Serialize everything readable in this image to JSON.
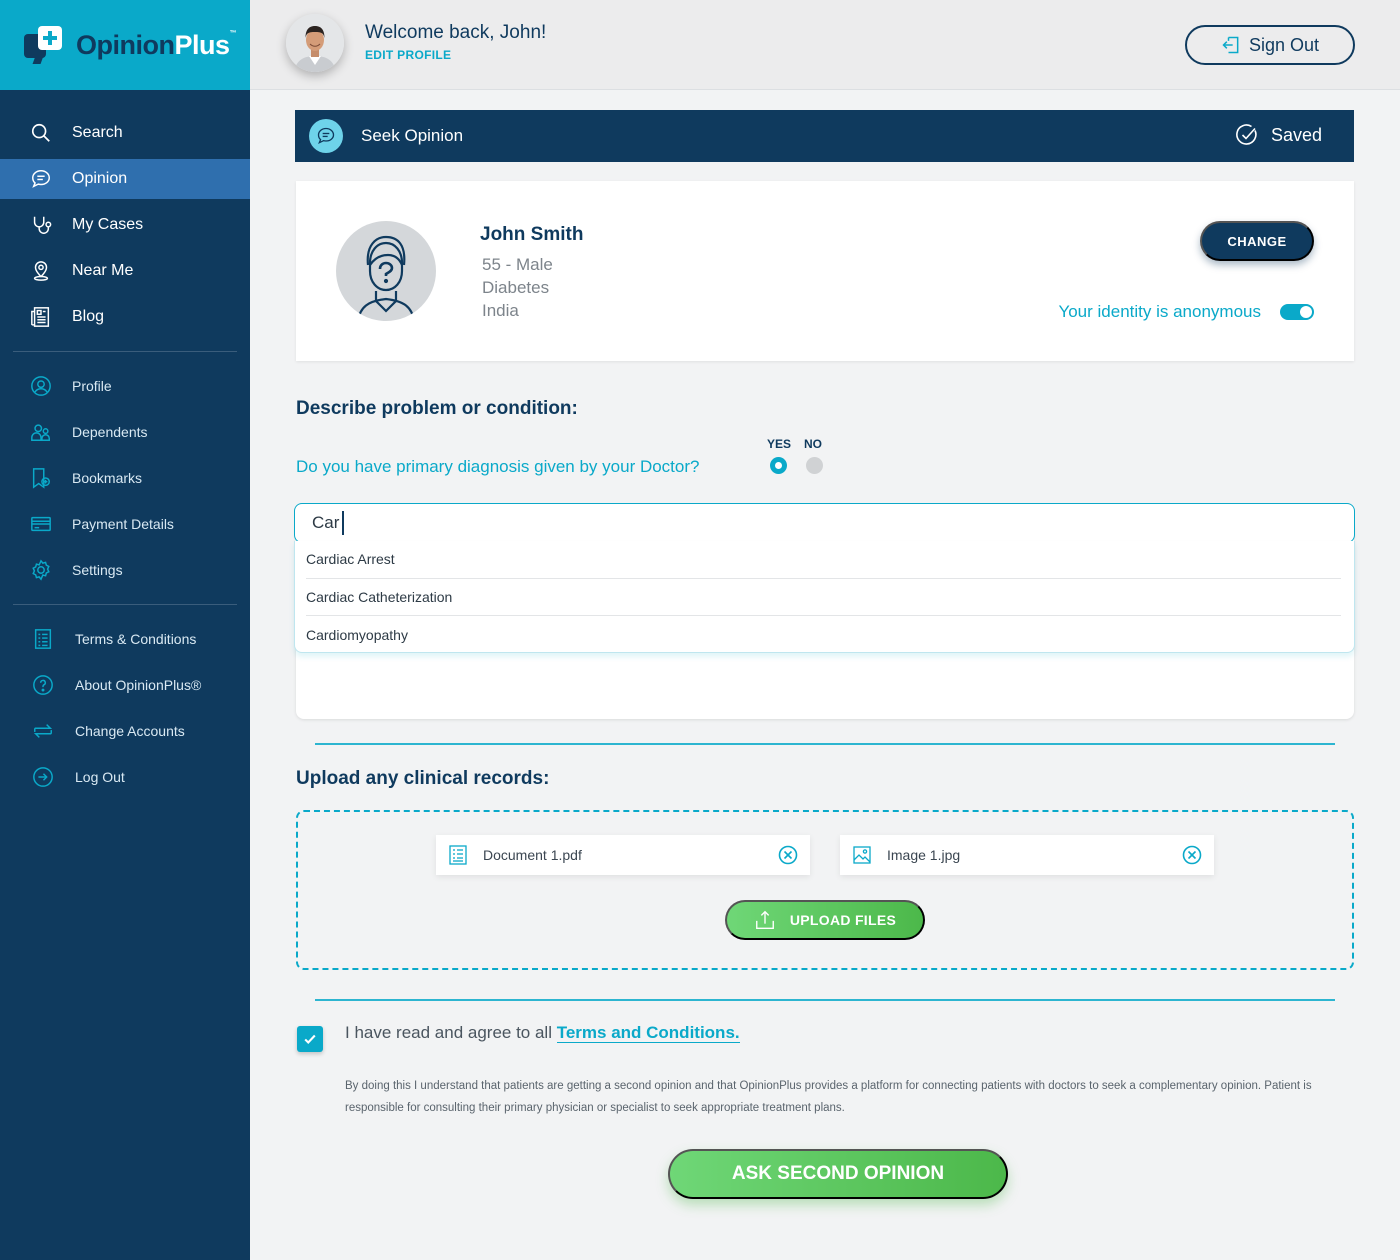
{
  "brand": {
    "name_main": "Opinion",
    "name_accent": "Plus",
    "tm": "™"
  },
  "sidebar": {
    "main": [
      {
        "label": "Search",
        "icon": "search-icon"
      },
      {
        "label": "Opinion",
        "icon": "chat-icon",
        "active": true
      },
      {
        "label": "My Cases",
        "icon": "stethoscope-icon"
      },
      {
        "label": "Near Me",
        "icon": "location-pin-icon"
      },
      {
        "label": "Blog",
        "icon": "newspaper-icon"
      }
    ],
    "account": [
      {
        "label": "Profile",
        "icon": "profile-icon"
      },
      {
        "label": "Dependents",
        "icon": "dependents-icon"
      },
      {
        "label": "Bookmarks",
        "icon": "bookmark-icon"
      },
      {
        "label": "Payment Details",
        "icon": "credit-card-icon"
      },
      {
        "label": "Settings",
        "icon": "gear-icon"
      }
    ],
    "misc": [
      {
        "label": "Terms & Conditions",
        "icon": "document-list-icon"
      },
      {
        "label": "About OpinionPlus®",
        "icon": "question-circle-icon"
      },
      {
        "label": "Change Accounts",
        "icon": "swap-icon"
      },
      {
        "label": "Log Out",
        "icon": "logout-arrow-icon"
      }
    ]
  },
  "header": {
    "welcome": "Welcome back, John!",
    "edit_profile": "EDIT PROFILE",
    "sign_out": "Sign Out"
  },
  "banner": {
    "title": "Seek Opinion",
    "status": "Saved"
  },
  "patient": {
    "name": "John Smith",
    "age_gender": "55 - Male",
    "condition": "Diabetes",
    "country": "India",
    "change_label": "CHANGE",
    "anonymous_label": "Your identity is anonymous",
    "anonymous": true
  },
  "describe": {
    "title": "Describe problem or condition:",
    "question": "Do you have primary diagnosis given by your Doctor?",
    "yes_label": "YES",
    "no_label": "NO",
    "selected": "YES",
    "search_value": "Car",
    "suggestions": [
      "Cardiac Arrest",
      "Cardiac Catheterization",
      "Cardiomyopathy"
    ]
  },
  "upload": {
    "title": "Upload any clinical records:",
    "files": [
      {
        "name": "Document 1.pdf",
        "icon": "document-icon"
      },
      {
        "name": "Image 1.jpg",
        "icon": "image-icon"
      }
    ],
    "button": "UPLOAD FILES"
  },
  "agreement": {
    "checked": true,
    "text": "I have read and agree to all ",
    "link": "Terms and Conditions.",
    "disclaimer": "By doing this I understand that patients are getting a second opinion and that OpinionPlus provides a platform for connecting patients with doctors to seek a complementary opinion. Patient is responsible for consulting their primary physician or specialist to seek appropriate treatment plans."
  },
  "submit_label": "ASK SECOND OPINION",
  "colors": {
    "navy": "#0f3a5e",
    "cyan": "#0aa9c9",
    "active_nav": "#2f6fae",
    "green": "#5bc75d"
  }
}
